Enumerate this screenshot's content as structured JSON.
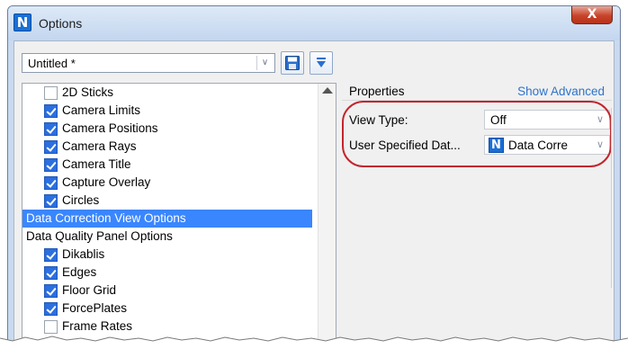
{
  "window": {
    "title": "Options",
    "app_icon_letter": "N",
    "close_glyph": "X"
  },
  "toolbar": {
    "preset_value": "Untitled *",
    "save_icon": "floppy-disk-icon",
    "menu_icon": "triangle-down-icon"
  },
  "list": {
    "items": [
      {
        "label": "2D Sticks",
        "type": "checkbox",
        "checked": false
      },
      {
        "label": "Camera Limits",
        "type": "checkbox",
        "checked": true
      },
      {
        "label": "Camera Positions",
        "type": "checkbox",
        "checked": true
      },
      {
        "label": "Camera Rays",
        "type": "checkbox",
        "checked": true
      },
      {
        "label": "Camera Title",
        "type": "checkbox",
        "checked": true
      },
      {
        "label": "Capture Overlay",
        "type": "checkbox",
        "checked": true
      },
      {
        "label": "Circles",
        "type": "checkbox",
        "checked": true
      },
      {
        "label": "Data Correction View Options",
        "type": "group",
        "selected": true
      },
      {
        "label": "Data Quality Panel Options",
        "type": "group",
        "selected": false
      },
      {
        "label": "Dikablis",
        "type": "checkbox",
        "checked": true
      },
      {
        "label": "Edges",
        "type": "checkbox",
        "checked": true
      },
      {
        "label": "Floor Grid",
        "type": "checkbox",
        "checked": true
      },
      {
        "label": "ForcePlates",
        "type": "checkbox",
        "checked": true
      },
      {
        "label": "Frame Rates",
        "type": "checkbox",
        "checked": false
      }
    ]
  },
  "properties": {
    "title": "Properties",
    "show_advanced": "Show Advanced",
    "rows": [
      {
        "label": "View Type:",
        "value": "Off"
      },
      {
        "label": "User Specified Dat...",
        "value": "Data Corre",
        "icon_letter": "N"
      }
    ]
  },
  "colors": {
    "selection": "#3a86ff",
    "highlight_oval": "#c2252e",
    "link": "#2e73c9"
  }
}
